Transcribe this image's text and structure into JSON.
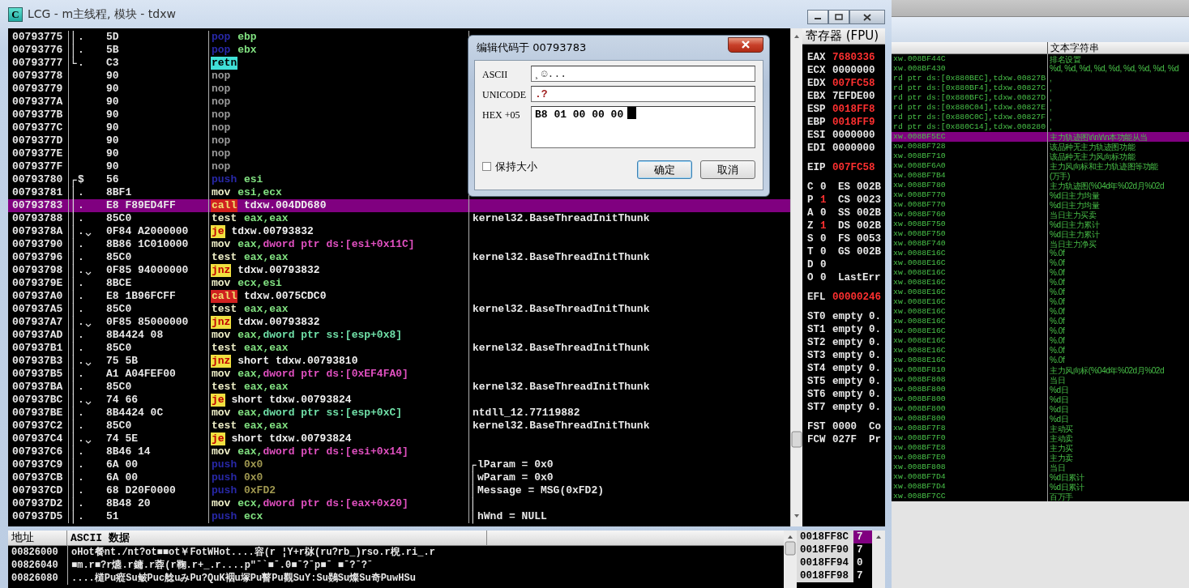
{
  "window": {
    "title": "LCG - m主线程, 模块 - tdxw",
    "icon_text": "C"
  },
  "disassembly": {
    "rows": [
      {
        "address": "00793775",
        "bracket": "│",
        "marker": ".",
        "jump": false,
        "hex": "5D",
        "mnemonic": "pop",
        "kind": "stack",
        "operands": [
          {
            "text": "ebp",
            "kind": "reg"
          }
        ],
        "selected": false
      },
      {
        "address": "00793776",
        "bracket": "│",
        "marker": ".",
        "jump": false,
        "hex": "5B",
        "mnemonic": "pop",
        "kind": "stack",
        "operands": [
          {
            "text": "ebx",
            "kind": "reg"
          }
        ],
        "selected": false
      },
      {
        "address": "00793777",
        "bracket": "└",
        "marker": ".",
        "jump": false,
        "hex": "C3",
        "mnemonic": "retn",
        "kind": "ret",
        "selected": false
      },
      {
        "address": "00793778",
        "hex": "90",
        "jump": false,
        "mnemonic": "nop",
        "kind": "nop",
        "selected": false
      },
      {
        "address": "00793779",
        "hex": "90",
        "jump": false,
        "mnemonic": "nop",
        "kind": "nop",
        "selected": false
      },
      {
        "address": "0079377A",
        "hex": "90",
        "jump": false,
        "mnemonic": "nop",
        "kind": "nop",
        "selected": false
      },
      {
        "address": "0079377B",
        "hex": "90",
        "jump": false,
        "mnemonic": "nop",
        "kind": "nop",
        "selected": false
      },
      {
        "address": "0079377C",
        "hex": "90",
        "jump": false,
        "mnemonic": "nop",
        "kind": "nop",
        "selected": false
      },
      {
        "address": "0079377D",
        "hex": "90",
        "jump": false,
        "mnemonic": "nop",
        "kind": "nop",
        "selected": false
      },
      {
        "address": "0079377E",
        "hex": "90",
        "jump": false,
        "mnemonic": "nop",
        "kind": "nop",
        "selected": false
      },
      {
        "address": "0079377F",
        "hex": "90",
        "jump": false,
        "mnemonic": "nop",
        "kind": "nop",
        "selected": false
      },
      {
        "address": "00793780",
        "bracket": "┌",
        "marker": "$",
        "jump": false,
        "hex": "56",
        "mnemonic": "push",
        "kind": "stack",
        "operands": [
          {
            "text": "esi",
            "kind": "reg"
          }
        ],
        "selected": false
      },
      {
        "address": "00793781",
        "bracket": "│",
        "marker": ".",
        "jump": false,
        "hex": "8BF1",
        "mnemonic": "mov",
        "kind": "plain",
        "operands": [
          {
            "text": "esi,ecx",
            "kind": "reg"
          }
        ],
        "selected": false
      },
      {
        "address": "00793783",
        "bracket": "│",
        "marker": ".",
        "jump": false,
        "hex": "E8 F89ED4FF",
        "mnemonic": "call",
        "kind": "call",
        "operands": [
          {
            "text": "tdxw.004DD680",
            "kind": "label"
          }
        ],
        "selected": true
      },
      {
        "address": "00793788",
        "bracket": "│",
        "marker": ".",
        "jump": false,
        "hex": "85C0",
        "mnemonic": "test",
        "kind": "plain",
        "operands": [
          {
            "text": "eax,eax",
            "kind": "reg"
          }
        ],
        "comment": "kernel32.BaseThreadInitThunk",
        "selected": false
      },
      {
        "address": "0079378A",
        "bracket": "│",
        "marker": ".",
        "jump": true,
        "hex": "0F84 A2000000",
        "mnemonic": "je",
        "kind": "jump",
        "operands": [
          {
            "text": "tdxw.00793832",
            "kind": "label"
          }
        ],
        "selected": false
      },
      {
        "address": "00793790",
        "bracket": "│",
        "marker": ".",
        "jump": false,
        "hex": "8B86 1C010000",
        "mnemonic": "mov",
        "kind": "plain",
        "operands": [
          {
            "text": "eax,",
            "kind": "reg"
          },
          {
            "text": "dword ptr ds:[esi+0x11C]",
            "kind": "mem"
          }
        ],
        "selected": false
      },
      {
        "address": "00793796",
        "bracket": "│",
        "marker": ".",
        "jump": false,
        "hex": "85C0",
        "mnemonic": "test",
        "kind": "plain",
        "operands": [
          {
            "text": "eax,eax",
            "kind": "reg"
          }
        ],
        "comment": "kernel32.BaseThreadInitThunk",
        "selected": false
      },
      {
        "address": "00793798",
        "bracket": "│",
        "marker": ".",
        "jump": true,
        "hex": "0F85 94000000",
        "mnemonic": "jnz",
        "kind": "jump",
        "operands": [
          {
            "text": "tdxw.00793832",
            "kind": "label"
          }
        ],
        "selected": false
      },
      {
        "address": "0079379E",
        "bracket": "│",
        "marker": ".",
        "jump": false,
        "hex": "8BCE",
        "mnemonic": "mov",
        "kind": "plain",
        "operands": [
          {
            "text": "ecx,esi",
            "kind": "reg"
          }
        ],
        "selected": false
      },
      {
        "address": "007937A0",
        "bracket": "│",
        "marker": ".",
        "jump": false,
        "hex": "E8 1B96FCFF",
        "mnemonic": "call",
        "kind": "call",
        "operands": [
          {
            "text": "tdxw.0075CDC0",
            "kind": "label"
          }
        ],
        "selected": false
      },
      {
        "address": "007937A5",
        "bracket": "│",
        "marker": ".",
        "jump": false,
        "hex": "85C0",
        "mnemonic": "test",
        "kind": "plain",
        "operands": [
          {
            "text": "eax,eax",
            "kind": "reg"
          }
        ],
        "comment": "kernel32.BaseThreadInitThunk",
        "selected": false
      },
      {
        "address": "007937A7",
        "bracket": "│",
        "marker": ".",
        "jump": true,
        "hex": "0F85 85000000",
        "mnemonic": "jnz",
        "kind": "jump",
        "operands": [
          {
            "text": "tdxw.00793832",
            "kind": "label"
          }
        ],
        "selected": false
      },
      {
        "address": "007937AD",
        "bracket": "│",
        "marker": ".",
        "jump": false,
        "hex": "8B4424 08",
        "mnemonic": "mov",
        "kind": "plain",
        "operands": [
          {
            "text": "eax,",
            "kind": "reg"
          },
          {
            "text": "dword ptr ss:[esp+0x8]",
            "kind": "stackmem"
          }
        ],
        "selected": false
      },
      {
        "address": "007937B1",
        "bracket": "│",
        "marker": ".",
        "jump": false,
        "hex": "85C0",
        "mnemonic": "test",
        "kind": "plain",
        "operands": [
          {
            "text": "eax,eax",
            "kind": "reg"
          }
        ],
        "comment": "kernel32.BaseThreadInitThunk",
        "selected": false
      },
      {
        "address": "007937B3",
        "bracket": "│",
        "marker": ".",
        "jump": true,
        "hex": "75 5B",
        "mnemonic": "jnz",
        "kind": "jump",
        "operands": [
          {
            "text": "short tdxw.00793810",
            "kind": "label"
          }
        ],
        "selected": false
      },
      {
        "address": "007937B5",
        "bracket": "│",
        "marker": ".",
        "jump": false,
        "hex": "A1 A04FEF00",
        "mnemonic": "mov",
        "kind": "plain",
        "operands": [
          {
            "text": "eax,",
            "kind": "reg"
          },
          {
            "text": "dword ptr ds:[0xEF4FA0]",
            "kind": "mem"
          }
        ],
        "selected": false
      },
      {
        "address": "007937BA",
        "bracket": "│",
        "marker": ".",
        "jump": false,
        "hex": "85C0",
        "mnemonic": "test",
        "kind": "plain",
        "operands": [
          {
            "text": "eax,eax",
            "kind": "reg"
          }
        ],
        "comment": "kernel32.BaseThreadInitThunk",
        "selected": false
      },
      {
        "address": "007937BC",
        "bracket": "│",
        "marker": ".",
        "jump": true,
        "hex": "74 66",
        "mnemonic": "je",
        "kind": "jump",
        "operands": [
          {
            "text": "short tdxw.00793824",
            "kind": "label"
          }
        ],
        "selected": false
      },
      {
        "address": "007937BE",
        "bracket": "│",
        "marker": ".",
        "jump": false,
        "hex": "8B4424 0C",
        "mnemonic": "mov",
        "kind": "plain",
        "operands": [
          {
            "text": "eax,",
            "kind": "reg"
          },
          {
            "text": "dword ptr ss:[esp+0xC]",
            "kind": "stackmem"
          }
        ],
        "comment": "ntdll_12.77119882",
        "selected": false
      },
      {
        "address": "007937C2",
        "bracket": "│",
        "marker": ".",
        "jump": false,
        "hex": "85C0",
        "mnemonic": "test",
        "kind": "plain",
        "operands": [
          {
            "text": "eax,eax",
            "kind": "reg"
          }
        ],
        "comment": "kernel32.BaseThreadInitThunk",
        "selected": false
      },
      {
        "address": "007937C4",
        "bracket": "│",
        "marker": ".",
        "jump": true,
        "hex": "74 5E",
        "mnemonic": "je",
        "kind": "jump",
        "operands": [
          {
            "text": "short tdxw.00793824",
            "kind": "label"
          }
        ],
        "selected": false
      },
      {
        "address": "007937C6",
        "bracket": "│",
        "marker": ".",
        "jump": false,
        "hex": "8B46 14",
        "mnemonic": "mov",
        "kind": "plain",
        "operands": [
          {
            "text": "eax,",
            "kind": "reg"
          },
          {
            "text": "dword ptr ds:[esi+0x14]",
            "kind": "mem"
          }
        ],
        "selected": false
      },
      {
        "address": "007937C9",
        "bracket": "│",
        "marker": ".",
        "jump": false,
        "hex": "6A 00",
        "mnemonic": "push",
        "kind": "stack",
        "operands": [
          {
            "text": "0x0",
            "kind": "imm"
          }
        ],
        "comment": "lParam = 0x0",
        "comment_bracket": "┌",
        "selected": false
      },
      {
        "address": "007937CB",
        "bracket": "│",
        "marker": ".",
        "jump": false,
        "hex": "6A 00",
        "mnemonic": "push",
        "kind": "stack",
        "operands": [
          {
            "text": "0x0",
            "kind": "imm"
          }
        ],
        "comment": "wParam = 0x0",
        "comment_bracket": "│",
        "selected": false
      },
      {
        "address": "007937CD",
        "bracket": "│",
        "marker": ".",
        "jump": false,
        "hex": "68 D20F0000",
        "mnemonic": "push",
        "kind": "stack",
        "operands": [
          {
            "text": "0xFD2",
            "kind": "imm"
          }
        ],
        "comment": "Message = MSG(0xFD2)",
        "comment_bracket": "│",
        "selected": false
      },
      {
        "address": "007937D2",
        "bracket": "│",
        "marker": ".",
        "jump": false,
        "hex": "8B48 20",
        "mnemonic": "mov",
        "kind": "plain",
        "operands": [
          {
            "text": "ecx,",
            "kind": "reg"
          },
          {
            "text": "dword ptr ds:[eax+0x20]",
            "kind": "mem"
          }
        ],
        "comment_bracket": "│",
        "selected": false
      },
      {
        "address": "007937D5",
        "bracket": "│",
        "marker": ".",
        "jump": false,
        "hex": "51",
        "mnemonic": "push",
        "kind": "stack",
        "operands": [
          {
            "text": "ecx",
            "kind": "reg"
          }
        ],
        "comment": "hWnd = NULL",
        "comment_bracket": "│",
        "selected": false
      }
    ]
  },
  "registers": {
    "title": "寄存器 (FPU)",
    "groups": [
      [
        {
          "name": "EAX",
          "value": "7680336",
          "changed": true
        },
        {
          "name": "ECX",
          "value": "0000000",
          "changed": false
        },
        {
          "name": "EDX",
          "value": "007FC58",
          "changed": true
        },
        {
          "name": "EBX",
          "value": "7EFDE00",
          "changed": false
        },
        {
          "name": "ESP",
          "value": "0018FF8",
          "changed": true
        },
        {
          "name": "EBP",
          "value": "0018FF9",
          "changed": true
        },
        {
          "name": "ESI",
          "value": "0000000",
          "changed": false
        },
        {
          "name": "EDI",
          "value": "0000000",
          "changed": false
        }
      ],
      [
        {
          "name": "EIP",
          "value": "007FC58",
          "changed": true
        }
      ],
      [
        {
          "name": "C",
          "value": "0",
          "changed": false,
          "segment": "ES",
          "segment_value": "002B"
        },
        {
          "name": "P",
          "value": "1",
          "changed": true,
          "segment": "CS",
          "segment_value": "0023"
        },
        {
          "name": "A",
          "value": "0",
          "changed": false,
          "segment": "SS",
          "segment_value": "002B"
        },
        {
          "name": "Z",
          "value": "1",
          "changed": true,
          "segment": "DS",
          "segment_value": "002B"
        },
        {
          "name": "S",
          "value": "0",
          "changed": false,
          "segment": "FS",
          "segment_value": "0053"
        },
        {
          "name": "T",
          "value": "0",
          "changed": false,
          "segment": "GS",
          "segment_value": "002B"
        },
        {
          "name": "D",
          "value": "0",
          "changed": false
        },
        {
          "name": "O",
          "value": "0",
          "changed": false,
          "segment": "LastErr"
        }
      ],
      [
        {
          "name": "EFL",
          "value": "00000246",
          "changed": true
        }
      ],
      [
        {
          "name": "ST0",
          "value": "empty 0.",
          "changed": false
        },
        {
          "name": "ST1",
          "value": "empty 0.",
          "changed": false
        },
        {
          "name": "ST2",
          "value": "empty 0.",
          "changed": false
        },
        {
          "name": "ST3",
          "value": "empty 0.",
          "changed": false
        },
        {
          "name": "ST4",
          "value": "empty 0.",
          "changed": false
        },
        {
          "name": "ST5",
          "value": "empty 0.",
          "changed": false
        },
        {
          "name": "ST6",
          "value": "empty 0.",
          "changed": false
        },
        {
          "name": "ST7",
          "value": "empty 0.",
          "changed": false
        }
      ],
      [
        {
          "name": "FST",
          "value": "0000",
          "changed": false,
          "segment": "Co"
        },
        {
          "name": "FCW",
          "value": "027F",
          "changed": false,
          "segment": "Pr"
        }
      ]
    ]
  },
  "dump": {
    "columns": [
      "地址",
      "ASCII 数据"
    ],
    "rows": [
      {
        "address": "00826000",
        "ascii": "oHot餐nt./nt?ot■■ot￥FotWHot....容(r ¦Y+r栤(ru?rb_)rso.r棿.ri_.r"
      },
      {
        "address": "00826040",
        "ascii": "■m.r■?r爊.r鏞.r蓉(r鞠.r+_.r....p\"ˉ`■ˉ.0■ˉ?ˉp■ˉ ■ˉ?ˉ?ˉ"
      },
      {
        "address": "00826080",
        "ascii": "....檤Pu瘲Su鲏Puc艌uみPu?QuK裀u塚Pu瞽Pu觀SuY:Su鷃Su燦Su奇PuwHSu"
      }
    ]
  },
  "stack": {
    "rows": [
      {
        "address": "0018FF8C",
        "value": "7",
        "selected": true
      },
      {
        "address": "0018FF90",
        "value": "7",
        "selected": false
      },
      {
        "address": "0018FF94",
        "value": "0",
        "selected": false
      },
      {
        "address": "0018FF98",
        "value": "7",
        "selected": false
      }
    ]
  },
  "dialog": {
    "title": "编辑代码于 00793783",
    "fields": [
      {
        "label": "ASCII",
        "value": "¸☺..."
      },
      {
        "label": "UNICODE",
        "value": ".?"
      },
      {
        "label": "HEX +05",
        "value": "B8 01 00 00 00",
        "cursor": true
      }
    ],
    "checkbox": {
      "label": "保持大小",
      "checked": false
    },
    "buttons": [
      {
        "label": "确定",
        "default": true
      },
      {
        "label": "取消",
        "default": false
      }
    ]
  },
  "strings_window": {
    "header": "文本字符串",
    "rows": [
      {
        "address": "xw.008BF44C",
        "text": "排名设置",
        "selected": false
      },
      {
        "address": "xw.008BF430",
        "text": "%d, %d, %d, %d, %d, %d, %d, %d, %d",
        "selected": false
      },
      {
        "address": "rd ptr ds:[0x880BEC],tdxw.00827B",
        "text": ",",
        "selected": false
      },
      {
        "address": "rd ptr ds:[0x880BF4],tdxw.00827C",
        "text": ",",
        "selected": false
      },
      {
        "address": "rd ptr ds:[0x880BFC],tdxw.00827D",
        "text": ",",
        "selected": false
      },
      {
        "address": "rd ptr ds:[0x880C04],tdxw.00827E",
        "text": ",",
        "selected": false
      },
      {
        "address": "rd ptr ds:[0x880C0C],tdxw.00827F",
        "text": ",",
        "selected": false
      },
      {
        "address": "rd ptr ds:[0x880C14],tdxw.008280",
        "text": ",",
        "selected": false
      },
      {
        "address": "xw.008BF5EC",
        "text": "主力轨迹图\\r\\n\\r\\n本功能从当",
        "selected": true
      },
      {
        "address": "xw.008BF728",
        "text": "该品种无主力轨迹图功能",
        "selected": false
      },
      {
        "address": "xw.008BF710",
        "text": "该品种无主力风向标功能",
        "selected": false
      },
      {
        "address": "xw.008BF6A0",
        "text": "主力风向标和主力轨迹图等功能",
        "selected": false
      },
      {
        "address": "xw.008BF7B4",
        "text": "(万手)",
        "selected": false
      },
      {
        "address": "xw.008BF780",
        "text": "主力轨迹图(%04d年%02d月%02d",
        "selected": false
      },
      {
        "address": "xw.008BF770",
        "text": "%d日主力均量",
        "selected": false
      },
      {
        "address": "xw.008BF770",
        "text": "%d日主力均量",
        "selected": false
      },
      {
        "address": "xw.008BF760",
        "text": "当日主力买卖",
        "selected": false
      },
      {
        "address": "xw.008BF750",
        "text": "%d日主力累计",
        "selected": false
      },
      {
        "address": "xw.008BF750",
        "text": "%d日主力累计",
        "selected": false
      },
      {
        "address": "xw.008BF740",
        "text": "当日主力净买",
        "selected": false
      },
      {
        "address": "xw.0088E16C",
        "text": "%.0f",
        "selected": false
      },
      {
        "address": "xw.0088E16C",
        "text": "%.0f",
        "selected": false
      },
      {
        "address": "xw.0088E16C",
        "text": "%.0f",
        "selected": false
      },
      {
        "address": "xw.0088E16C",
        "text": "%.0f",
        "selected": false
      },
      {
        "address": "xw.0088E16C",
        "text": "%.0f",
        "selected": false
      },
      {
        "address": "xw.0088E16C",
        "text": "%.0f",
        "selected": false
      },
      {
        "address": "xw.0088E16C",
        "text": "%.0f",
        "selected": false
      },
      {
        "address": "xw.0088E16C",
        "text": "%.0f",
        "selected": false
      },
      {
        "address": "xw.0088E16C",
        "text": "%.0f",
        "selected": false
      },
      {
        "address": "xw.0088E16C",
        "text": "%.0f",
        "selected": false
      },
      {
        "address": "xw.0088E16C",
        "text": "%.0f",
        "selected": false
      },
      {
        "address": "xw.0088E16C",
        "text": "%.0f",
        "selected": false
      },
      {
        "address": "xw.008BF810",
        "text": "主力风向标(%04d年%02d月%02d",
        "selected": false
      },
      {
        "address": "xw.008BF808",
        "text": "当日",
        "selected": false
      },
      {
        "address": "xw.008BF800",
        "text": "%d日",
        "selected": false
      },
      {
        "address": "xw.008BF800",
        "text": "%d日",
        "selected": false
      },
      {
        "address": "xw.008BF800",
        "text": "%d日",
        "selected": false
      },
      {
        "address": "xw.008BF800",
        "text": "%d日",
        "selected": false
      },
      {
        "address": "xw.008BF7F8",
        "text": "主动买",
        "selected": false
      },
      {
        "address": "xw.008BF7F0",
        "text": "主动卖",
        "selected": false
      },
      {
        "address": "xw.008BF7E8",
        "text": "主力买",
        "selected": false
      },
      {
        "address": "xw.008BF7E0",
        "text": "主力卖",
        "selected": false
      },
      {
        "address": "xw.008BF808",
        "text": "当日",
        "selected": false
      },
      {
        "address": "xw.008BF7D4",
        "text": "%d日累计",
        "selected": false
      },
      {
        "address": "xw.008BF7D4",
        "text": "%d日累计",
        "selected": false
      },
      {
        "address": "xw.008BF7CC",
        "text": "百万手",
        "selected": false
      }
    ]
  }
}
